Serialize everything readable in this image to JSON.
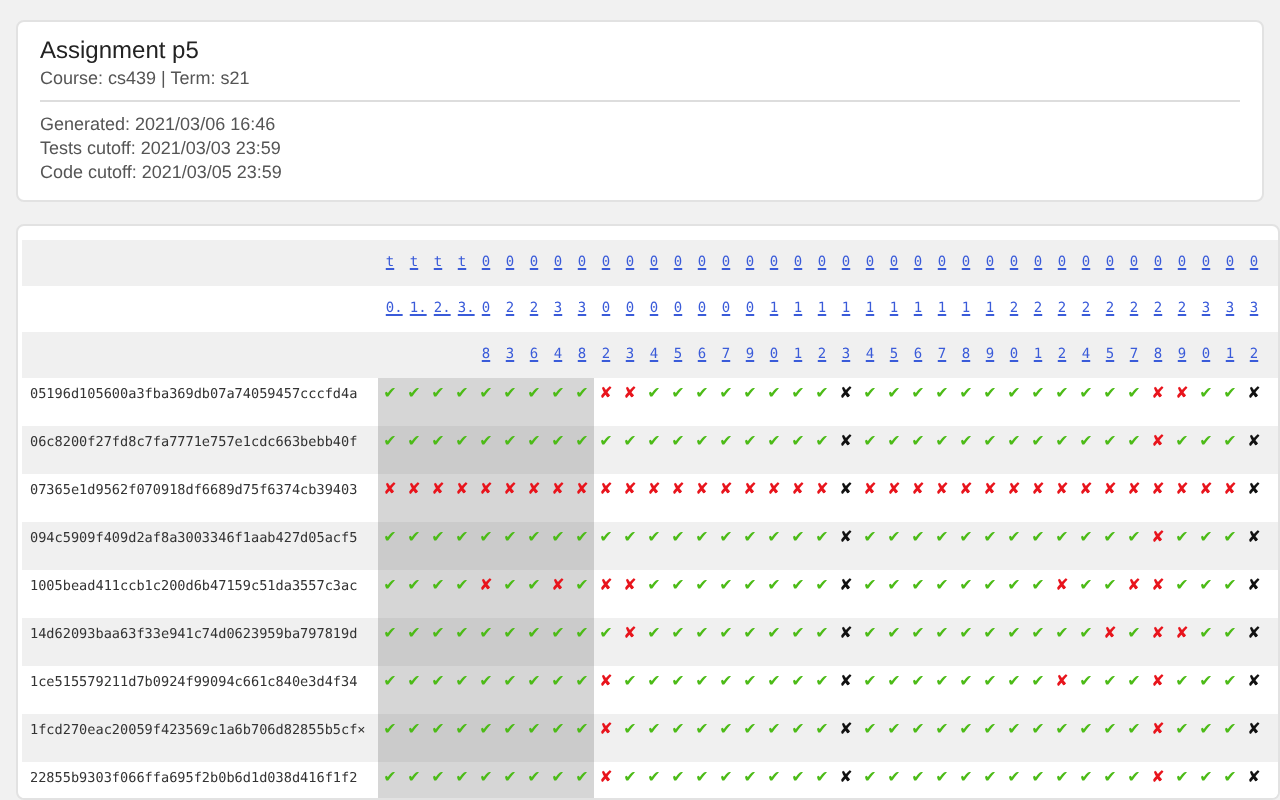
{
  "header": {
    "title": "Assignment p5",
    "subtitle": "Course: cs439 | Term: s21",
    "details": [
      "Generated: 2021/03/06 16:46",
      "Tests cutoff: 2021/03/03 23:59",
      "Code cutoff: 2021/03/05 23:59"
    ]
  },
  "table": {
    "columns": [
      {
        "label": "t0.",
        "highlighted": true,
        "unavailable": false
      },
      {
        "label": "t1.",
        "highlighted": true,
        "unavailable": false
      },
      {
        "label": "t2.",
        "highlighted": true,
        "unavailable": false
      },
      {
        "label": "t3.",
        "highlighted": true,
        "unavailable": false
      },
      {
        "label": "008",
        "highlighted": true,
        "unavailable": false
      },
      {
        "label": "023",
        "highlighted": true,
        "unavailable": false
      },
      {
        "label": "026",
        "highlighted": true,
        "unavailable": false
      },
      {
        "label": "034",
        "highlighted": true,
        "unavailable": false
      },
      {
        "label": "038",
        "highlighted": true,
        "unavailable": false
      },
      {
        "label": "002",
        "highlighted": false,
        "unavailable": false
      },
      {
        "label": "003",
        "highlighted": false,
        "unavailable": false
      },
      {
        "label": "004",
        "highlighted": false,
        "unavailable": false
      },
      {
        "label": "005",
        "highlighted": false,
        "unavailable": false
      },
      {
        "label": "006",
        "highlighted": false,
        "unavailable": false
      },
      {
        "label": "007",
        "highlighted": false,
        "unavailable": false
      },
      {
        "label": "009",
        "highlighted": false,
        "unavailable": false
      },
      {
        "label": "010",
        "highlighted": false,
        "unavailable": false
      },
      {
        "label": "011",
        "highlighted": false,
        "unavailable": false
      },
      {
        "label": "012",
        "highlighted": false,
        "unavailable": false
      },
      {
        "label": "013",
        "highlighted": false,
        "unavailable": true
      },
      {
        "label": "014",
        "highlighted": false,
        "unavailable": false
      },
      {
        "label": "015",
        "highlighted": false,
        "unavailable": false
      },
      {
        "label": "016",
        "highlighted": false,
        "unavailable": false
      },
      {
        "label": "017",
        "highlighted": false,
        "unavailable": false
      },
      {
        "label": "018",
        "highlighted": false,
        "unavailable": false
      },
      {
        "label": "019",
        "highlighted": false,
        "unavailable": false
      },
      {
        "label": "020",
        "highlighted": false,
        "unavailable": false
      },
      {
        "label": "021",
        "highlighted": false,
        "unavailable": false
      },
      {
        "label": "022",
        "highlighted": false,
        "unavailable": false
      },
      {
        "label": "024",
        "highlighted": false,
        "unavailable": false
      },
      {
        "label": "025",
        "highlighted": false,
        "unavailable": false
      },
      {
        "label": "027",
        "highlighted": false,
        "unavailable": false
      },
      {
        "label": "028",
        "highlighted": false,
        "unavailable": false
      },
      {
        "label": "029",
        "highlighted": false,
        "unavailable": false
      },
      {
        "label": "030",
        "highlighted": false,
        "unavailable": false
      },
      {
        "label": "031",
        "highlighted": false,
        "unavailable": false
      },
      {
        "label": "032",
        "highlighted": false,
        "unavailable": true
      }
    ],
    "rows": [
      {
        "hash": "05196d105600a3fba369db07a74059457cccfd4a",
        "results": [
          "✔",
          "✔",
          "✔",
          "✔",
          "✔",
          "✔",
          "✔",
          "✔",
          "✔",
          "✘",
          "✘",
          "✔",
          "✔",
          "✔",
          "✔",
          "✔",
          "✔",
          "✔",
          "✔",
          "✘",
          "✔",
          "✔",
          "✔",
          "✔",
          "✔",
          "✔",
          "✔",
          "✔",
          "✔",
          "✔",
          "✔",
          "✔",
          "✘",
          "✘",
          "✔",
          "✔",
          "✘"
        ],
        "passed": [
          true,
          true,
          true,
          true,
          true,
          true,
          true,
          true,
          true,
          false,
          false,
          true,
          true,
          true,
          true,
          true,
          true,
          true,
          true,
          false,
          true,
          true,
          true,
          true,
          true,
          true,
          true,
          true,
          true,
          true,
          true,
          true,
          false,
          false,
          true,
          true,
          false
        ]
      },
      {
        "hash": "06c8200f27fd8c7fa7771e757e1cdc663bebb40f",
        "results": [
          "✔",
          "✔",
          "✔",
          "✔",
          "✔",
          "✔",
          "✔",
          "✔",
          "✔",
          "✔",
          "✔",
          "✔",
          "✔",
          "✔",
          "✔",
          "✔",
          "✔",
          "✔",
          "✔",
          "✘",
          "✔",
          "✔",
          "✔",
          "✔",
          "✔",
          "✔",
          "✔",
          "✔",
          "✔",
          "✔",
          "✔",
          "✔",
          "✘",
          "✔",
          "✔",
          "✔",
          "✘"
        ],
        "passed": [
          true,
          true,
          true,
          true,
          true,
          true,
          true,
          true,
          true,
          true,
          true,
          true,
          true,
          true,
          true,
          true,
          true,
          true,
          true,
          false,
          true,
          true,
          true,
          true,
          true,
          true,
          true,
          true,
          true,
          true,
          true,
          true,
          false,
          true,
          true,
          true,
          false
        ]
      },
      {
        "hash": "07365e1d9562f070918df6689d75f6374cb39403",
        "results": [
          "✘",
          "✘",
          "✘",
          "✘",
          "✘",
          "✘",
          "✘",
          "✘",
          "✘",
          "✘",
          "✘",
          "✘",
          "✘",
          "✘",
          "✘",
          "✘",
          "✘",
          "✘",
          "✘",
          "✘",
          "✘",
          "✘",
          "✘",
          "✘",
          "✘",
          "✘",
          "✘",
          "✘",
          "✘",
          "✘",
          "✘",
          "✘",
          "✘",
          "✘",
          "✘",
          "✘",
          "✘"
        ],
        "passed": [
          false,
          false,
          false,
          false,
          false,
          false,
          false,
          false,
          false,
          false,
          false,
          false,
          false,
          false,
          false,
          false,
          false,
          false,
          false,
          false,
          false,
          false,
          false,
          false,
          false,
          false,
          false,
          false,
          false,
          false,
          false,
          false,
          false,
          false,
          false,
          false,
          false
        ]
      },
      {
        "hash": "094c5909f409d2af8a3003346f1aab427d05acf5",
        "results": [
          "✔",
          "✔",
          "✔",
          "✔",
          "✔",
          "✔",
          "✔",
          "✔",
          "✔",
          "✔",
          "✔",
          "✔",
          "✔",
          "✔",
          "✔",
          "✔",
          "✔",
          "✔",
          "✔",
          "✘",
          "✔",
          "✔",
          "✔",
          "✔",
          "✔",
          "✔",
          "✔",
          "✔",
          "✔",
          "✔",
          "✔",
          "✔",
          "✘",
          "✔",
          "✔",
          "✔",
          "✘"
        ],
        "passed": [
          true,
          true,
          true,
          true,
          true,
          true,
          true,
          true,
          true,
          true,
          true,
          true,
          true,
          true,
          true,
          true,
          true,
          true,
          true,
          false,
          true,
          true,
          true,
          true,
          true,
          true,
          true,
          true,
          true,
          true,
          true,
          true,
          false,
          true,
          true,
          true,
          false
        ]
      },
      {
        "hash": "1005bead411ccb1c200d6b47159c51da3557c3ac",
        "results": [
          "✔",
          "✔",
          "✔",
          "✔",
          "✘",
          "✔",
          "✔",
          "✘",
          "✔",
          "✘",
          "✘",
          "✔",
          "✔",
          "✔",
          "✔",
          "✔",
          "✔",
          "✔",
          "✔",
          "✘",
          "✔",
          "✔",
          "✔",
          "✔",
          "✔",
          "✔",
          "✔",
          "✔",
          "✘",
          "✔",
          "✔",
          "✘",
          "✘",
          "✔",
          "✔",
          "✔",
          "✘"
        ],
        "passed": [
          true,
          true,
          true,
          true,
          false,
          true,
          true,
          false,
          true,
          false,
          false,
          true,
          true,
          true,
          true,
          true,
          true,
          true,
          true,
          false,
          true,
          true,
          true,
          true,
          true,
          true,
          true,
          true,
          false,
          true,
          true,
          false,
          false,
          true,
          true,
          true,
          false
        ]
      },
      {
        "hash": "14d62093baa63f33e941c74d0623959ba797819d",
        "results": [
          "✔",
          "✔",
          "✔",
          "✔",
          "✔",
          "✔",
          "✔",
          "✔",
          "✔",
          "✔",
          "✘",
          "✔",
          "✔",
          "✔",
          "✔",
          "✔",
          "✔",
          "✔",
          "✔",
          "✘",
          "✔",
          "✔",
          "✔",
          "✔",
          "✔",
          "✔",
          "✔",
          "✔",
          "✔",
          "✔",
          "✘",
          "✔",
          "✘",
          "✘",
          "✔",
          "✔",
          "✘"
        ],
        "passed": [
          true,
          true,
          true,
          true,
          true,
          true,
          true,
          true,
          true,
          true,
          false,
          true,
          true,
          true,
          true,
          true,
          true,
          true,
          true,
          false,
          true,
          true,
          true,
          true,
          true,
          true,
          true,
          true,
          true,
          true,
          false,
          true,
          false,
          false,
          true,
          true,
          false
        ]
      },
      {
        "hash": "1ce515579211d7b0924f99094c661c840e3d4f34",
        "results": [
          "✔",
          "✔",
          "✔",
          "✔",
          "✔",
          "✔",
          "✔",
          "✔",
          "✔",
          "✘",
          "✔",
          "✔",
          "✔",
          "✔",
          "✔",
          "✔",
          "✔",
          "✔",
          "✔",
          "✘",
          "✔",
          "✔",
          "✔",
          "✔",
          "✔",
          "✔",
          "✔",
          "✔",
          "✘",
          "✔",
          "✔",
          "✔",
          "✘",
          "✔",
          "✔",
          "✔",
          "✘"
        ],
        "passed": [
          true,
          true,
          true,
          true,
          true,
          true,
          true,
          true,
          true,
          false,
          true,
          true,
          true,
          true,
          true,
          true,
          true,
          true,
          true,
          false,
          true,
          true,
          true,
          true,
          true,
          true,
          true,
          true,
          false,
          true,
          true,
          true,
          false,
          true,
          true,
          true,
          false
        ]
      },
      {
        "hash": "1fcd270eac20059f423569c1a6b706d82855b5cf×",
        "results": [
          "✔",
          "✔",
          "✔",
          "✔",
          "✔",
          "✔",
          "✔",
          "✔",
          "✔",
          "✘",
          "✔",
          "✔",
          "✔",
          "✔",
          "✔",
          "✔",
          "✔",
          "✔",
          "✔",
          "✘",
          "✔",
          "✔",
          "✔",
          "✔",
          "✔",
          "✔",
          "✔",
          "✔",
          "✔",
          "✔",
          "✔",
          "✔",
          "✘",
          "✔",
          "✔",
          "✔",
          "✘"
        ],
        "passed": [
          true,
          true,
          true,
          true,
          true,
          true,
          true,
          true,
          true,
          false,
          true,
          true,
          true,
          true,
          true,
          true,
          true,
          true,
          true,
          false,
          true,
          true,
          true,
          true,
          true,
          true,
          true,
          true,
          true,
          true,
          true,
          true,
          false,
          true,
          true,
          true,
          false
        ]
      },
      {
        "hash": "22855b9303f066ffa695f2b0b6d1d038d416f1f2",
        "results": [
          "✔",
          "✔",
          "✔",
          "✔",
          "✔",
          "✔",
          "✔",
          "✔",
          "✔",
          "✘",
          "✔",
          "✔",
          "✔",
          "✔",
          "✔",
          "✔",
          "✔",
          "✔",
          "✔",
          "✘",
          "✔",
          "✔",
          "✔",
          "✔",
          "✔",
          "✔",
          "✔",
          "✔",
          "✔",
          "✔",
          "✔",
          "✔",
          "✘",
          "✔",
          "✔",
          "✔",
          "✘"
        ],
        "passed": [
          true,
          true,
          true,
          true,
          true,
          true,
          true,
          true,
          true,
          false,
          true,
          true,
          true,
          true,
          true,
          true,
          true,
          true,
          true,
          false,
          true,
          true,
          true,
          true,
          true,
          true,
          true,
          true,
          true,
          true,
          true,
          true,
          false,
          true,
          true,
          true,
          false
        ]
      }
    ]
  }
}
